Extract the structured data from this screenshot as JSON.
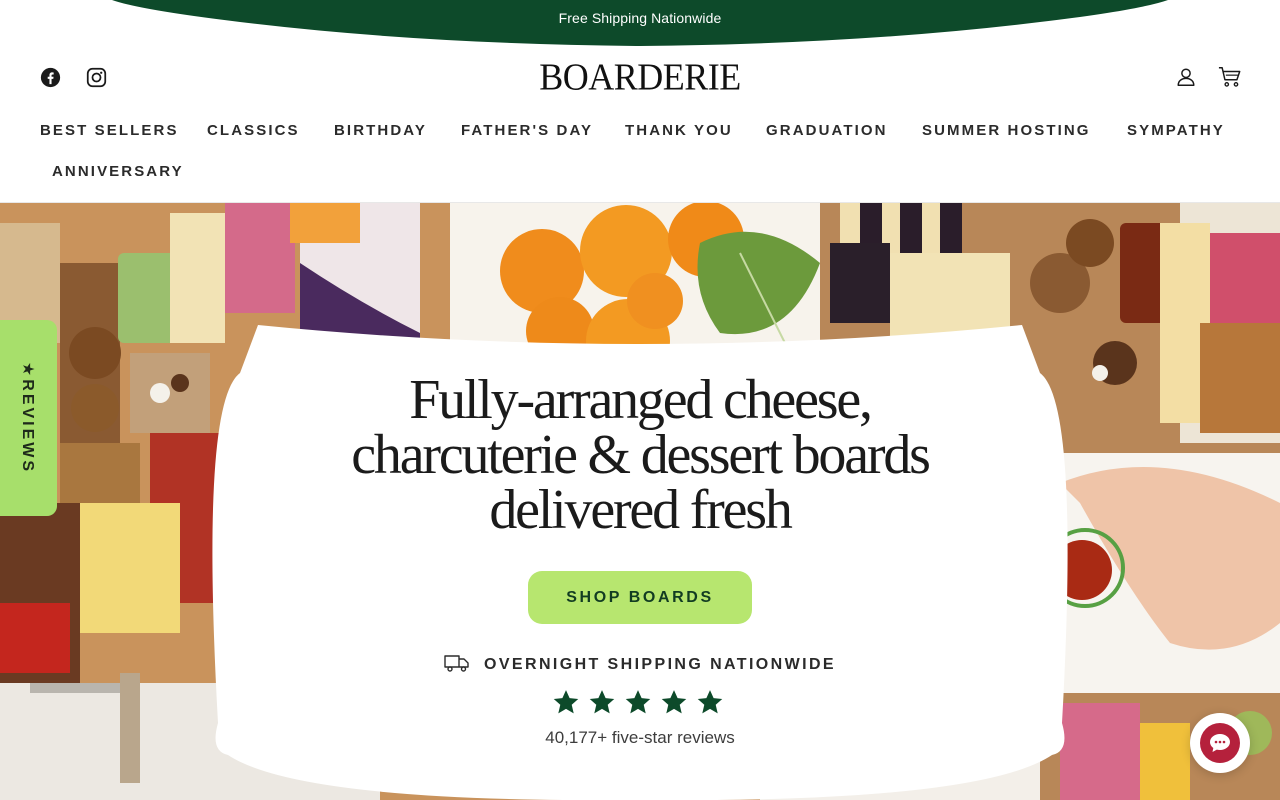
{
  "announcement": {
    "text": "Free Shipping Nationwide"
  },
  "header": {
    "logo": "BOARDERIE",
    "social_icons": [
      "facebook-icon",
      "instagram-icon"
    ],
    "utility_icons": [
      "account-icon",
      "cart-icon"
    ]
  },
  "nav": {
    "items": [
      {
        "label": "BEST SELLERS"
      },
      {
        "label": "CLASSICS"
      },
      {
        "label": "BIRTHDAY"
      },
      {
        "label": "FATHER'S DAY"
      },
      {
        "label": "THANK YOU"
      },
      {
        "label": "GRADUATION"
      },
      {
        "label": "SUMMER HOSTING"
      },
      {
        "label": "SYMPATHY"
      },
      {
        "label": "ANNIVERSARY"
      }
    ]
  },
  "hero": {
    "headline_line1": "Fully-arranged cheese,",
    "headline_line2": "charcuterie & dessert boards",
    "headline_line3": "delivered fresh",
    "cta_label": "SHOP BOARDS",
    "shipping_text": "OVERNIGHT SHIPPING NATIONWIDE",
    "rating_stars": 5,
    "reviews_text": "40,177+ five-star reviews"
  },
  "reviews_tab": {
    "label": "★REVIEWS"
  },
  "colors": {
    "brand_green": "#0d4a2a",
    "cta_green": "#b7e66f",
    "reviews_tab_green": "#a7df6b",
    "star_green": "#0d4a2a",
    "chat_red": "#b5213c"
  }
}
